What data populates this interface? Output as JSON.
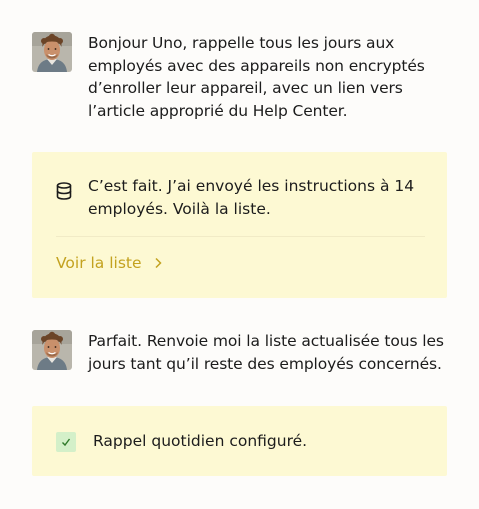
{
  "conversation": {
    "user_message_1": "Bonjour Uno, rappelle tous les jours aux employés avec des appareils non encryptés d’enroller leur appareil, avec un lien vers l’article approprié du Help Center.",
    "assistant_reply": "C’est fait. J’ai envoyé les instructions à 14 employés. Voilà la liste.",
    "view_list_link": "Voir la liste",
    "user_message_2": "Parfait. Renvoie moi la liste actualisée tous les jours tant qu’il reste des employés concernés.",
    "confirmation": "Rappel quotidien configuré."
  },
  "icons": {
    "database": "database-icon",
    "chevron": "chevron-right-icon",
    "check": "check-icon"
  },
  "colors": {
    "card_background": "#fdf9d3",
    "link": "#c3a21f",
    "check_background": "#d4f0c9",
    "check_mark": "#2f7a2a"
  }
}
